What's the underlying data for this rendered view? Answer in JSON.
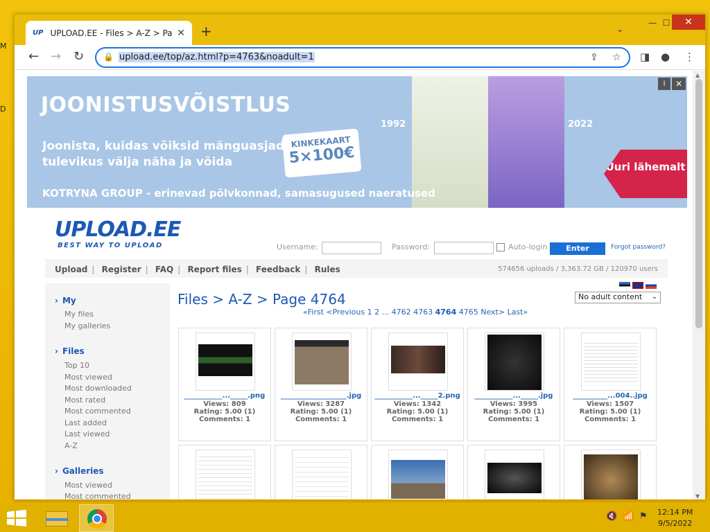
{
  "browser": {
    "tab_favicon": "UP",
    "tab_title": "UPLOAD.EE - Files > A-Z > Page 4764",
    "url": "upload.ee/top/az.html?p=4763&noadult=1"
  },
  "ad": {
    "headline": "JOONISTUSVÕISTLUS",
    "text": "Joonista, kuidas võiksid mänguasjad tulevikus välja näha ja võida",
    "card_line1": "KINKEKAART",
    "card_line2": "5×100€",
    "year_left": "1992",
    "year_right": "2022",
    "group": "KOTRYNA GROUP - erinevad põlvkonnad, samasugused naeratused",
    "cta": "Uuri lähemalt",
    "info": "i",
    "close": "✕"
  },
  "site": {
    "logo": "UPLOAD.EE",
    "tagline": "BEST WAY TO UPLOAD",
    "username_label": "Username:",
    "password_label": "Password:",
    "autologin_label": "Auto-login",
    "enter_label": "Enter",
    "forgot": "Forgot password?"
  },
  "menu": {
    "items": [
      "Upload",
      "Register",
      "FAQ",
      "Report files",
      "Feedback",
      "Rules"
    ],
    "stats": "574656 uploads  /  3,363.72 GB  /  120970 users"
  },
  "sidebar": {
    "my": {
      "title": "My",
      "items": [
        "My files",
        "My galleries"
      ]
    },
    "files": {
      "title": "Files",
      "items": [
        "Top 10",
        "Most viewed",
        "Most downloaded",
        "Most rated",
        "Most commented",
        "Last added",
        "Last viewed",
        "A-Z"
      ]
    },
    "galleries": {
      "title": "Galleries",
      "items": [
        "Most viewed",
        "Most commented"
      ]
    }
  },
  "main": {
    "title": "Files > A-Z > Page 4764",
    "filter": "No adult content",
    "pager": {
      "first": "«First",
      "prev": "<Previous",
      "p1": "1",
      "p2": "2",
      "dots": "...",
      "p4762": "4762",
      "p4763": "4763",
      "current": "4764",
      "p4765": "4765",
      "next": "Next>",
      "last": "Last»"
    },
    "files": [
      {
        "name": "___________..._____.png",
        "views": "Views: 809",
        "rating": "Rating: 5.00 (1)",
        "comments": "Comments: 1"
      },
      {
        "name": "___________________.jpg",
        "views": "Views: 3287",
        "rating": "Rating: 5.00 (1)",
        "comments": "Comments: 1"
      },
      {
        "name": "___________..._____2.png",
        "views": "Views: 1342",
        "rating": "Rating: 5.00 (1)",
        "comments": "Comments: 1"
      },
      {
        "name": "___________..._____.jpg",
        "views": "Views: 3995",
        "rating": "Rating: 5.00 (1)",
        "comments": "Comments: 1"
      },
      {
        "name": "__________...004..jpg",
        "views": "Views: 1507",
        "rating": "Rating: 5.00 (1)",
        "comments": "Comments: 1"
      }
    ]
  },
  "taskbar": {
    "time": "12:14 PM",
    "date": "9/5/2022"
  }
}
